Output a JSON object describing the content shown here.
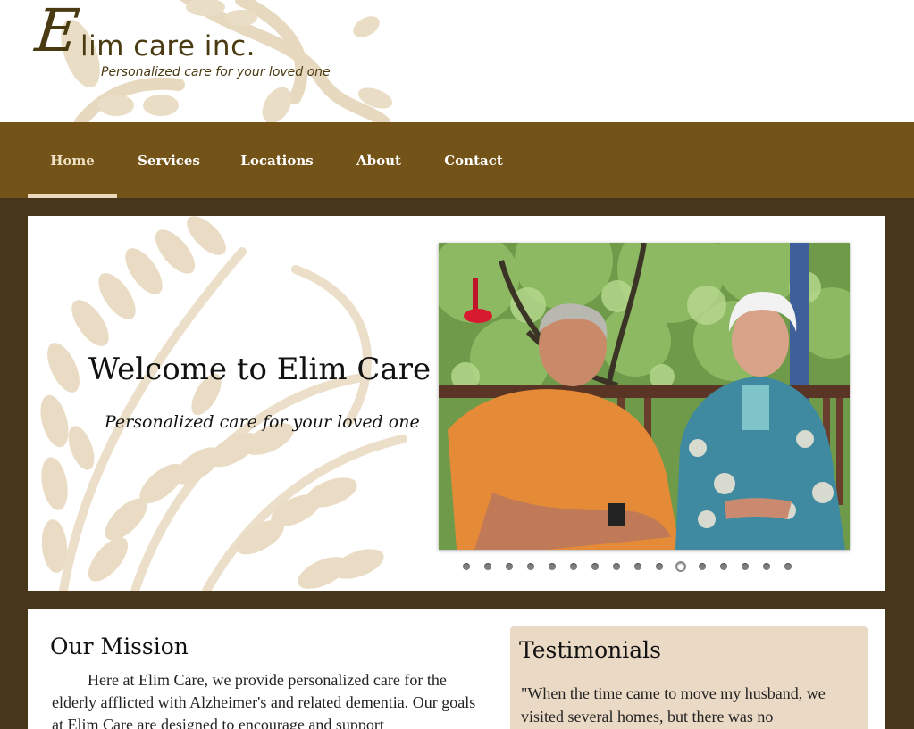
{
  "header": {
    "logo_initial": "E",
    "logo_rest": "lim care inc.",
    "tagline": "Personalized care for your loved one"
  },
  "nav": {
    "items": [
      {
        "label": "Home",
        "active": true
      },
      {
        "label": "Services",
        "active": false
      },
      {
        "label": "Locations",
        "active": false
      },
      {
        "label": "About",
        "active": false
      },
      {
        "label": "Contact",
        "active": false
      }
    ]
  },
  "hero": {
    "title": "Welcome to Elim Care",
    "subtitle": "Personalized care for your loved one",
    "slide_count": 16,
    "active_slide": 11
  },
  "mission": {
    "title": "Our Mission",
    "text": "Here at Elim Care, we provide personalized care for the elderly afflicted with Alzheimer's and related dementia. Our goals at Elim Care are designed to encourage and support"
  },
  "testimonials": {
    "title": "Testimonials",
    "text": "\"When the time came to move my husband, we visited several homes, but there was no"
  },
  "colors": {
    "nav_bg": "#735318",
    "page_bg": "#47361a",
    "active_underline": "#ead9bd",
    "testimonial_bg": "#ead9c5",
    "logo_text": "#4a3a12"
  }
}
